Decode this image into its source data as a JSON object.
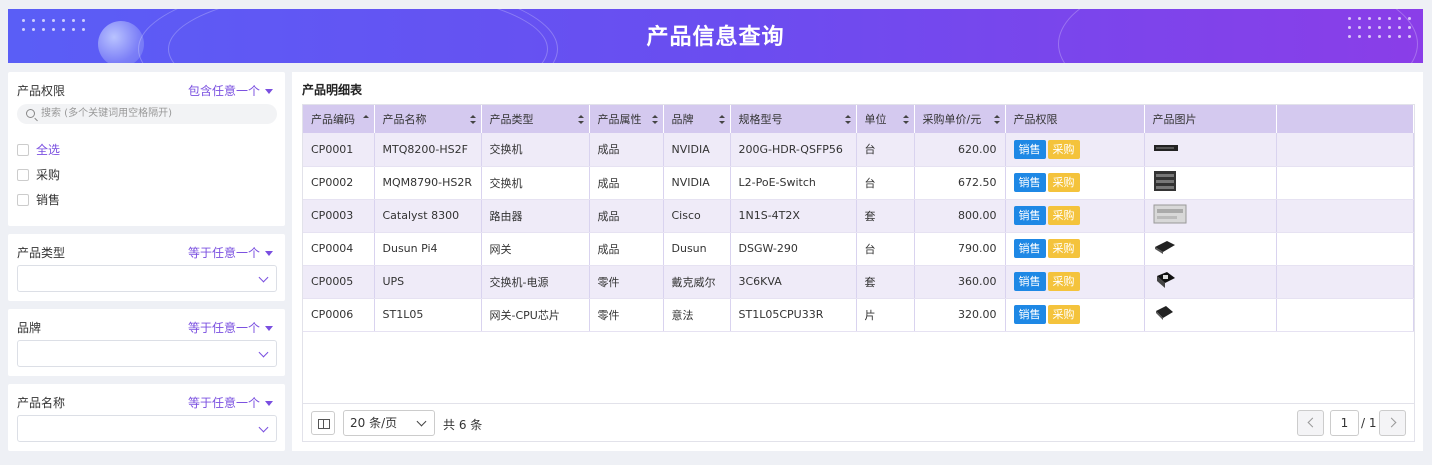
{
  "header": {
    "title": "产品信息查询"
  },
  "filters": {
    "permission": {
      "label": "产品权限",
      "mode": "包含任意一个",
      "search_placeholder": "搜索 (多个关键词用空格隔开)",
      "options": [
        "全选",
        "采购",
        "销售"
      ]
    },
    "type": {
      "label": "产品类型",
      "mode": "等于任意一个"
    },
    "brand": {
      "label": "品牌",
      "mode": "等于任意一个"
    },
    "name": {
      "label": "产品名称",
      "mode": "等于任意一个"
    }
  },
  "table": {
    "title": "产品明细表",
    "columns": [
      "产品编码",
      "产品名称",
      "产品类型",
      "产品属性",
      "品牌",
      "规格型号",
      "单位",
      "采购单价/元",
      "产品权限",
      "产品图片"
    ],
    "permission_tags": {
      "sale": "销售",
      "buy": "采购"
    },
    "rows": [
      {
        "code": "CP0001",
        "name": "MTQ8200-HS2F",
        "type": "交换机",
        "attr": "成品",
        "brand": "NVIDIA",
        "spec": "200G-HDR-QSFP56",
        "unit": "台",
        "price": "620.00",
        "img": "switch-1u-image"
      },
      {
        "code": "CP0002",
        "name": "MQM8790-HS2R",
        "type": "交换机",
        "attr": "成品",
        "brand": "NVIDIA",
        "spec": "L2-PoE-Switch",
        "unit": "台",
        "price": "672.50",
        "img": "switch-rack-image"
      },
      {
        "code": "CP0003",
        "name": "Catalyst 8300",
        "type": "路由器",
        "attr": "成品",
        "brand": "Cisco",
        "spec": "1N1S-4T2X",
        "unit": "套",
        "price": "800.00",
        "img": "router-image"
      },
      {
        "code": "CP0004",
        "name": "Dusun Pi4",
        "type": "网关",
        "attr": "成品",
        "brand": "Dusun",
        "spec": "DSGW-290",
        "unit": "台",
        "price": "790.00",
        "img": "gateway-image"
      },
      {
        "code": "CP0005",
        "name": "UPS",
        "type": "交换机-电源",
        "attr": "零件",
        "brand": "戴克威尔",
        "spec": "3C6KVA",
        "unit": "套",
        "price": "360.00",
        "img": "ups-image"
      },
      {
        "code": "CP0006",
        "name": "ST1L05",
        "type": "网关-CPU芯片",
        "attr": "零件",
        "brand": "意法",
        "spec": "ST1L05CPU33R",
        "unit": "片",
        "price": "320.00",
        "img": "chip-image"
      }
    ]
  },
  "pagination": {
    "page_size": "20 条/页",
    "total": "共 6 条",
    "current": "1",
    "pages": "/ 1"
  }
}
